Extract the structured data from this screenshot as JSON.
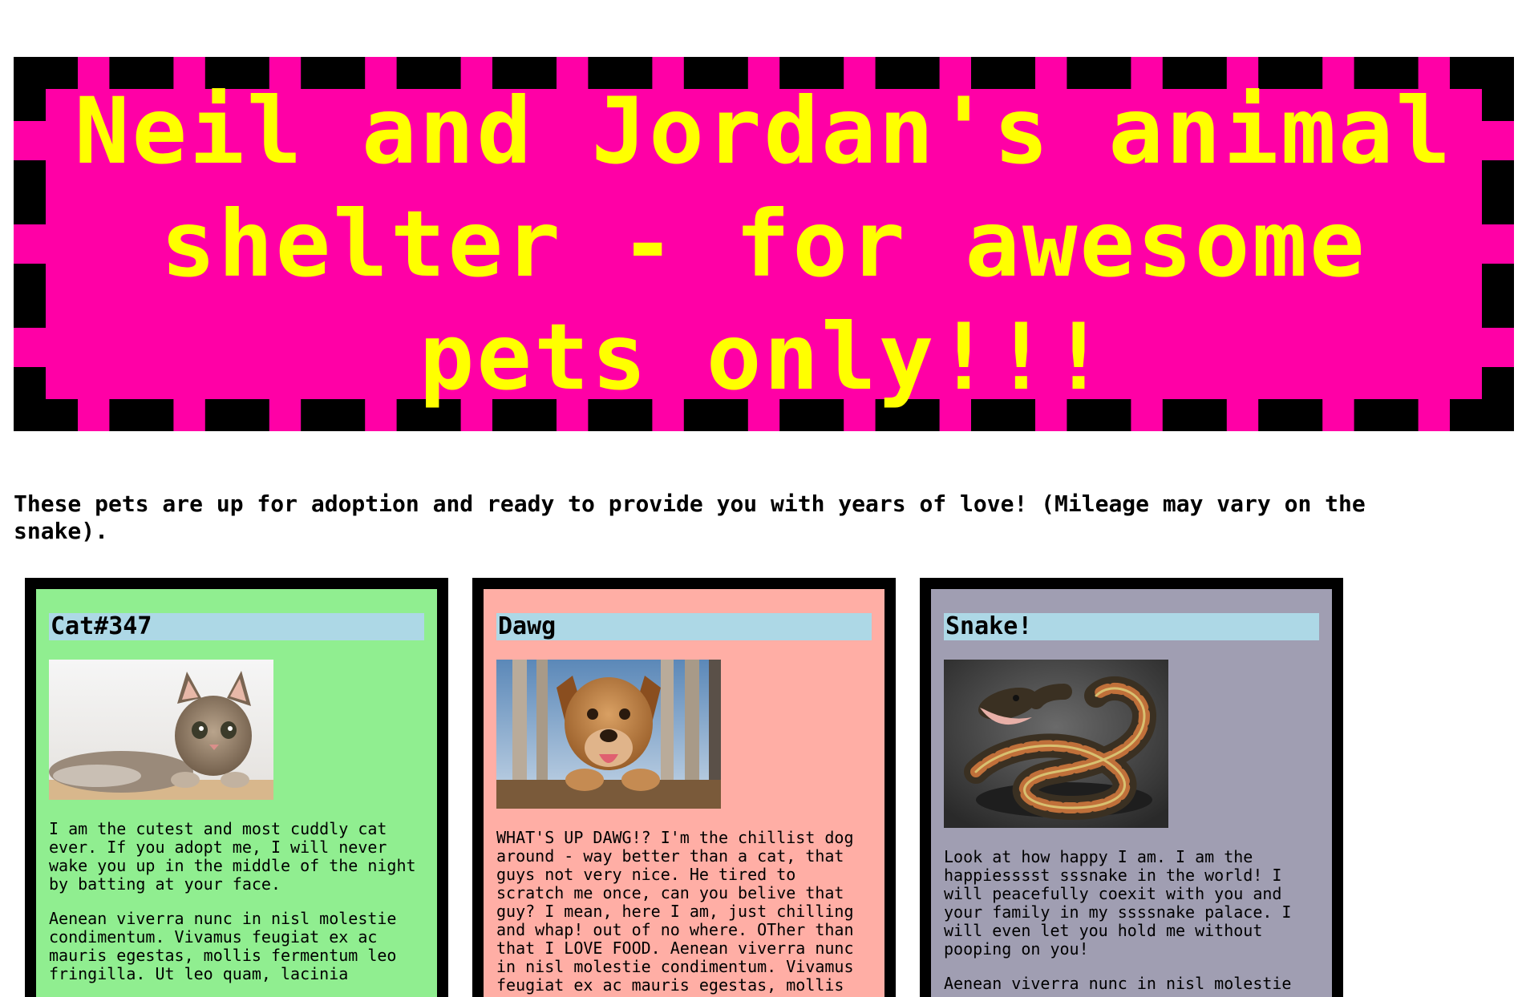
{
  "page": {
    "background": "#ffffff"
  },
  "header": {
    "title": "Neil and Jordan's animal shelter - for awesome pets only!!!",
    "background": "#ff00a6",
    "text_color": "#ffff00",
    "border": "dashed black"
  },
  "intro": {
    "text": "These pets are up for adoption and ready to provide you with years of love! (Mileage may vary on the snake)."
  },
  "pets": [
    {
      "name": "Cat#347",
      "image": "kitten-photo",
      "card_color": "#90ee90",
      "paragraphs": [
        "I am the cutest and most cuddly cat ever. If you adopt me, I will never wake you up in the middle of the night by batting at your face.",
        "Aenean viverra nunc in nisl molestie condimentum. Vivamus feugiat ex ac mauris egestas, mollis fermentum leo fringilla. Ut leo quam, lacinia"
      ]
    },
    {
      "name": "Dawg",
      "image": "puppy-photo",
      "card_color": "#ffaea5",
      "paragraphs": [
        "WHAT'S UP DAWG!? I'm the chillist dog around - way better than a cat, that guys not very nice. He tired to scratch me once, can you belive that guy? I mean, here I am, just chilling and whap! out of no where. OTher than that I LOVE FOOD. Aenean viverra nunc in nisl molestie condimentum. Vivamus feugiat ex ac mauris egestas, mollis"
      ]
    },
    {
      "name": "Snake!",
      "image": "snake-photo",
      "card_color": "#a09eb2",
      "paragraphs": [
        "Look at how happy I am. I am the happiesssst sssnake in the world! I will peacefully coexit with you and your family in my ssssnake palace. I will even let you hold me without pooping on you!",
        "Aenean viverra nunc in nisl molestie"
      ]
    }
  ],
  "card_name_background": "#add8e6"
}
